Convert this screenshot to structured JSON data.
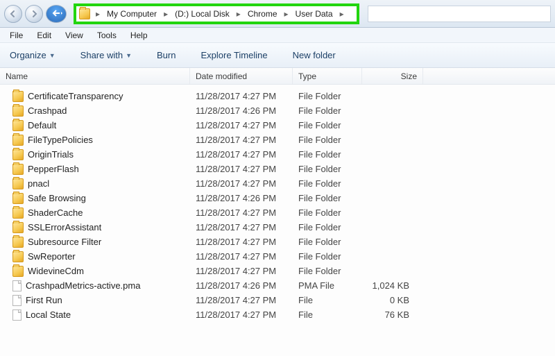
{
  "breadcrumbs": [
    "My Computer",
    "(D:) Local Disk",
    "Chrome",
    "User Data"
  ],
  "menu": {
    "file": "File",
    "edit": "Edit",
    "view": "View",
    "tools": "Tools",
    "help": "Help"
  },
  "toolbar": {
    "organize": "Organize",
    "share": "Share with",
    "burn": "Burn",
    "timeline": "Explore Timeline",
    "newfolder": "New folder"
  },
  "columns": {
    "name": "Name",
    "date": "Date modified",
    "type": "Type",
    "size": "Size"
  },
  "rows": [
    {
      "icon": "folder",
      "name": "CertificateTransparency",
      "date": "11/28/2017 4:27 PM",
      "type": "File Folder",
      "size": ""
    },
    {
      "icon": "folder",
      "name": "Crashpad",
      "date": "11/28/2017 4:26 PM",
      "type": "File Folder",
      "size": ""
    },
    {
      "icon": "folder",
      "name": "Default",
      "date": "11/28/2017 4:27 PM",
      "type": "File Folder",
      "size": ""
    },
    {
      "icon": "folder",
      "name": "FileTypePolicies",
      "date": "11/28/2017 4:27 PM",
      "type": "File Folder",
      "size": ""
    },
    {
      "icon": "folder",
      "name": "OriginTrials",
      "date": "11/28/2017 4:27 PM",
      "type": "File Folder",
      "size": ""
    },
    {
      "icon": "folder",
      "name": "PepperFlash",
      "date": "11/28/2017 4:27 PM",
      "type": "File Folder",
      "size": ""
    },
    {
      "icon": "folder",
      "name": "pnacl",
      "date": "11/28/2017 4:27 PM",
      "type": "File Folder",
      "size": ""
    },
    {
      "icon": "folder",
      "name": "Safe Browsing",
      "date": "11/28/2017 4:26 PM",
      "type": "File Folder",
      "size": ""
    },
    {
      "icon": "folder",
      "name": "ShaderCache",
      "date": "11/28/2017 4:27 PM",
      "type": "File Folder",
      "size": ""
    },
    {
      "icon": "folder",
      "name": "SSLErrorAssistant",
      "date": "11/28/2017 4:27 PM",
      "type": "File Folder",
      "size": ""
    },
    {
      "icon": "folder",
      "name": "Subresource Filter",
      "date": "11/28/2017 4:27 PM",
      "type": "File Folder",
      "size": ""
    },
    {
      "icon": "folder",
      "name": "SwReporter",
      "date": "11/28/2017 4:27 PM",
      "type": "File Folder",
      "size": ""
    },
    {
      "icon": "folder",
      "name": "WidevineCdm",
      "date": "11/28/2017 4:27 PM",
      "type": "File Folder",
      "size": ""
    },
    {
      "icon": "file",
      "name": "CrashpadMetrics-active.pma",
      "date": "11/28/2017 4:26 PM",
      "type": "PMA File",
      "size": "1,024 KB"
    },
    {
      "icon": "file",
      "name": "First Run",
      "date": "11/28/2017 4:27 PM",
      "type": "File",
      "size": "0 KB"
    },
    {
      "icon": "file",
      "name": "Local State",
      "date": "11/28/2017 4:27 PM",
      "type": "File",
      "size": "76 KB"
    }
  ]
}
